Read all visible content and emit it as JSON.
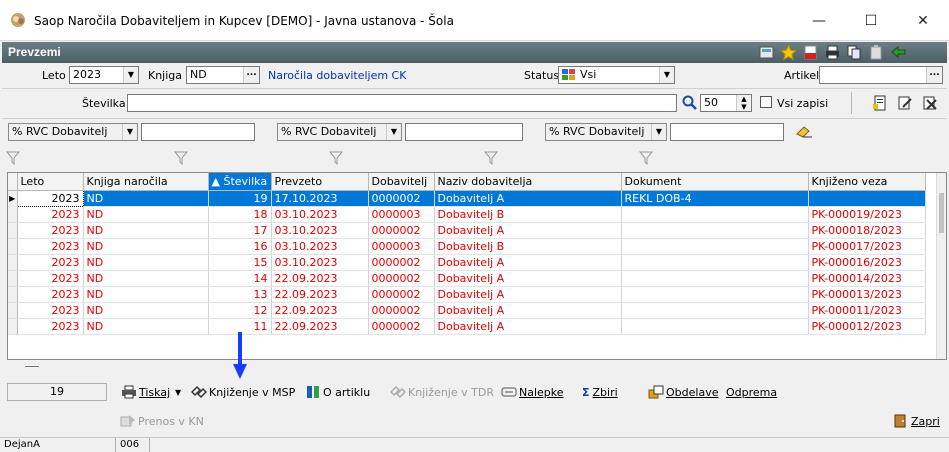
{
  "window": {
    "title": "Saop  Naročila Dobaviteljem in Kupcev [DEMO] - Javna ustanova - Šola",
    "minimize": "—",
    "maximize": "☐",
    "close": "✕"
  },
  "header": {
    "caption": "Prevzemi"
  },
  "filters": {
    "leto_label": "Leto",
    "leto_value": "2023",
    "knjiga_label": "Knjiga",
    "knjiga_value": "ND",
    "knjiga_link": "Naročila dobaviteljem CK",
    "status_label": "Status",
    "status_value": "Vsi",
    "artikel_label": "Artikel",
    "artikel_value": "",
    "stevilka_label": "Številka",
    "stevilka_value": "",
    "limit_value": "50",
    "vsi_zapisi_label": "Vsi zapisi",
    "vsi_zapisi_checked": false,
    "rvc1_label": "% RVC Dobavitelj",
    "rvc1_value": "",
    "rvc2_label": "% RVC Dobavitelj",
    "rvc2_value": "",
    "rvc3_label": "% RVC Dobavitelj",
    "rvc3_value": ""
  },
  "grid": {
    "columns": [
      "Leto",
      "Knjiga naročila",
      "▲ Številka",
      "Prevzeto",
      "Dobavitelj",
      "Naziv dobavitelja",
      "Dokument",
      "Knjiženo veza"
    ],
    "rows": [
      {
        "leto": "2023",
        "knjiga": "ND",
        "stevilka": "19",
        "prevzeto": "17.10.2023",
        "dobavitelj": "0000002",
        "naziv": "Dobavitelj A",
        "dokument": "REKL DOB-4",
        "veza": "",
        "selected": true
      },
      {
        "leto": "2023",
        "knjiga": "ND",
        "stevilka": "18",
        "prevzeto": "03.10.2023",
        "dobavitelj": "0000003",
        "naziv": "Dobavitelj B",
        "dokument": "",
        "veza": "PK-000019/2023"
      },
      {
        "leto": "2023",
        "knjiga": "ND",
        "stevilka": "17",
        "prevzeto": "03.10.2023",
        "dobavitelj": "0000002",
        "naziv": "Dobavitelj A",
        "dokument": "",
        "veza": "PK-000018/2023"
      },
      {
        "leto": "2023",
        "knjiga": "ND",
        "stevilka": "16",
        "prevzeto": "03.10.2023",
        "dobavitelj": "0000003",
        "naziv": "Dobavitelj B",
        "dokument": "",
        "veza": "PK-000017/2023"
      },
      {
        "leto": "2023",
        "knjiga": "ND",
        "stevilka": "15",
        "prevzeto": "03.10.2023",
        "dobavitelj": "0000002",
        "naziv": "Dobavitelj A",
        "dokument": "",
        "veza": "PK-000016/2023"
      },
      {
        "leto": "2023",
        "knjiga": "ND",
        "stevilka": "14",
        "prevzeto": "22.09.2023",
        "dobavitelj": "0000002",
        "naziv": "Dobavitelj A",
        "dokument": "",
        "veza": "PK-000014/2023"
      },
      {
        "leto": "2023",
        "knjiga": "ND",
        "stevilka": "13",
        "prevzeto": "22.09.2023",
        "dobavitelj": "0000002",
        "naziv": "Dobavitelj A",
        "dokument": "",
        "veza": "PK-000013/2023"
      },
      {
        "leto": "2023",
        "knjiga": "ND",
        "stevilka": "12",
        "prevzeto": "22.09.2023",
        "dobavitelj": "0000002",
        "naziv": "Dobavitelj A",
        "dokument": "",
        "veza": "PK-000011/2023"
      },
      {
        "leto": "2023",
        "knjiga": "ND",
        "stevilka": "11",
        "prevzeto": "22.09.2023",
        "dobavitelj": "0000002",
        "naziv": "Dobavitelj A",
        "dokument": "",
        "veza": "PK-000012/2023"
      }
    ]
  },
  "toolbar": {
    "count": "19",
    "tiskaj": "Tiskaj",
    "knjizenje_msp": "Knjiženje v MSP",
    "o_artiklu": "O artiklu",
    "knjizenje_tdr": "Knjiženje v TDR",
    "nalepke": "Nalepke",
    "zbiri": "Zbiri",
    "obdelave": "Obdelave",
    "odprema": "Odprema",
    "prenos_kn": "Prenos v KN",
    "zapri": "Zapri"
  },
  "statusbar": {
    "user": "DejanA",
    "code": "006"
  },
  "colors": {
    "selection": "#0078d7",
    "row_text": "#e00000",
    "header_band": "#56686f",
    "annotation_arrow": "#1a3cff"
  },
  "icons": [
    "app-icon",
    "calculator-icon",
    "star-icon",
    "pdf-icon",
    "print-icon",
    "copy-icon",
    "paste-icon",
    "exit-icon",
    "search-icon",
    "filter-icon",
    "eraser-icon",
    "printer-icon",
    "link-icon",
    "article-icon",
    "label-icon",
    "sum-icon",
    "process-icon",
    "transfer-icon",
    "close-door-icon"
  ]
}
